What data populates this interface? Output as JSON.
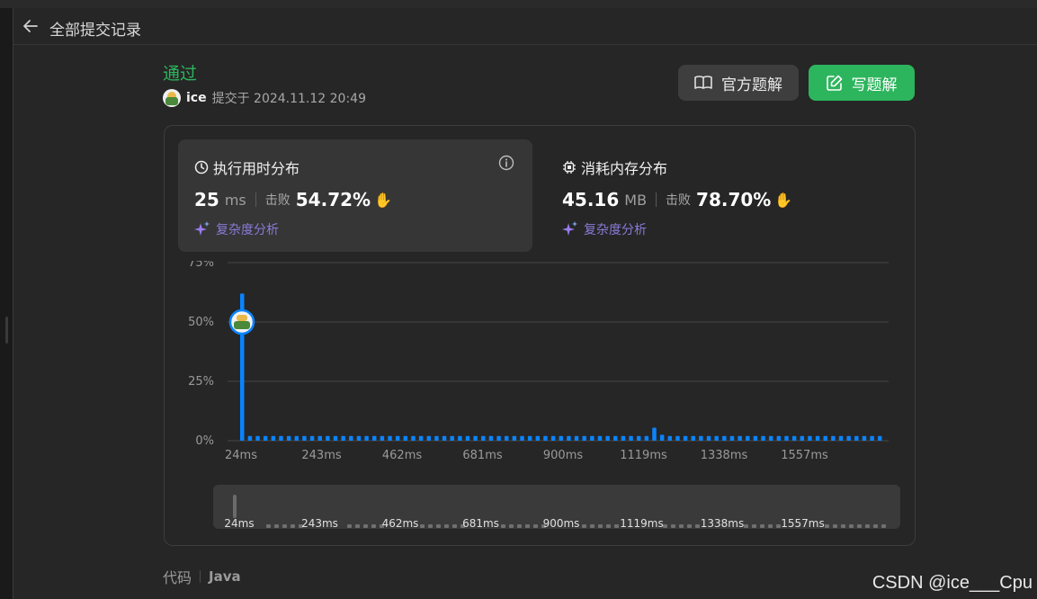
{
  "header": {
    "title": "全部提交记录"
  },
  "submission": {
    "status": "通过",
    "user": "ice",
    "submitted_text": "提交于 2024.11.12 20:49"
  },
  "actions": {
    "official_solution": "官方题解",
    "write_solution": "写题解"
  },
  "runtime": {
    "title": "执行用时分布",
    "value": "25",
    "unit": "ms",
    "beat_label": "击败",
    "beat_percent": "54.72%",
    "analysis": "复杂度分析"
  },
  "memory": {
    "title": "消耗内存分布",
    "value": "45.16",
    "unit": "MB",
    "beat_label": "击败",
    "beat_percent": "78.70%",
    "analysis": "复杂度分析"
  },
  "chart_data": {
    "type": "bar",
    "title": "",
    "xlabel": "",
    "ylabel": "",
    "y_ticks": [
      "75%",
      "50%",
      "25%",
      "0%"
    ],
    "ylim": [
      0,
      75
    ],
    "x_ticks": [
      "24ms",
      "243ms",
      "462ms",
      "681ms",
      "900ms",
      "1119ms",
      "1338ms",
      "1557ms"
    ],
    "values": [
      62,
      2,
      2,
      2,
      2,
      2,
      2,
      2,
      2,
      2,
      2,
      2,
      2,
      2,
      2,
      2,
      2,
      2,
      2,
      2,
      2,
      2,
      2,
      2,
      2,
      2,
      2,
      2,
      2,
      2,
      2,
      2,
      2,
      2,
      2,
      2,
      2,
      2,
      2,
      2,
      2,
      2,
      2,
      2,
      2,
      2,
      2,
      2,
      2,
      2,
      2,
      2,
      2,
      5.5,
      2.5,
      2,
      2,
      2,
      2,
      2,
      2,
      2,
      2,
      2,
      2,
      2,
      2,
      2,
      2,
      2,
      2,
      2,
      2,
      2,
      2,
      2,
      2,
      2,
      2,
      2,
      2,
      2,
      2
    ],
    "user_bar_index": 0,
    "user_value": 50,
    "bar_color": "#0a84ff",
    "grid": true
  },
  "range_slider": {
    "labels": [
      "24ms",
      "243ms",
      "462ms",
      "681ms",
      "900ms",
      "1119ms",
      "1338ms",
      "1557ms"
    ]
  },
  "footer": {
    "code_tab": "代码",
    "language": "Java"
  },
  "watermark": "CSDN @ice___Cpu"
}
